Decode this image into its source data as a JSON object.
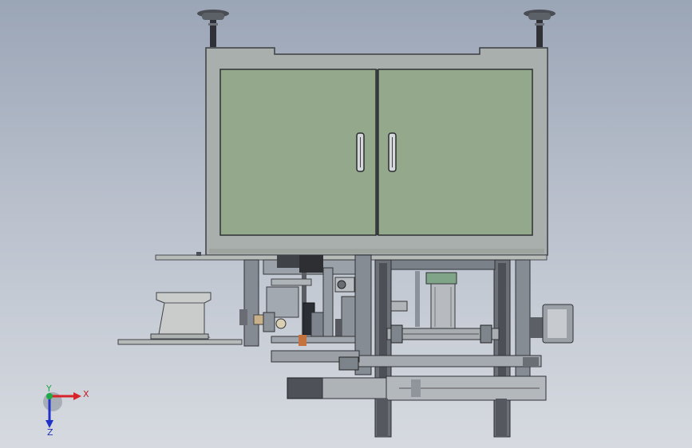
{
  "axes": {
    "x_label": "X",
    "y_label": "Y",
    "z_label": "Z",
    "x_color": "#d8232a",
    "y_color": "#22a845",
    "z_color": "#2032c8"
  },
  "colors": {
    "cabinet_frame": "#aab0ad",
    "cabinet_door": "#93a88a",
    "machine_metal": "#8f959d",
    "dark_steel": "#3d3f44",
    "profile": "#666a70"
  }
}
